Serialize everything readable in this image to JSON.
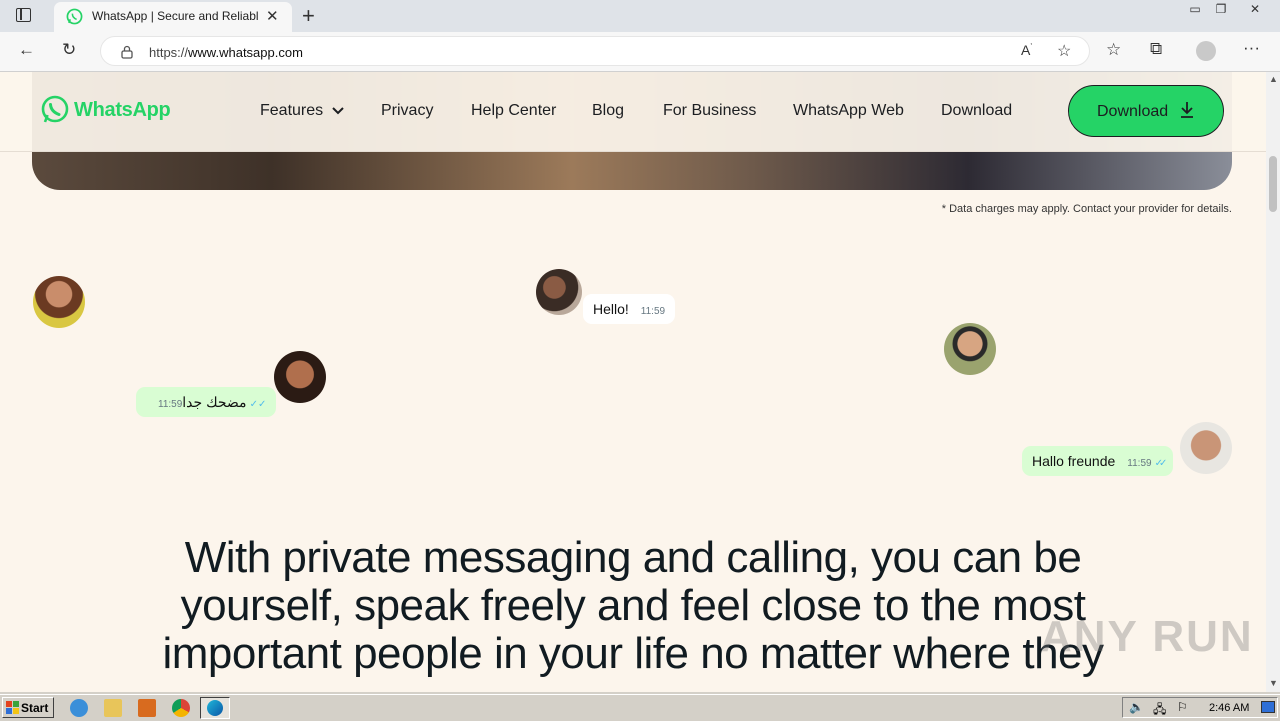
{
  "browser": {
    "tab_title": "WhatsApp | Secure and Reliable",
    "url_scheme": "https://",
    "url_host": "www.whatsapp.com",
    "new_tab_label": "+"
  },
  "site": {
    "logo_text": "WhatsApp",
    "nav": {
      "features": "Features",
      "privacy": "Privacy",
      "help_center": "Help Center",
      "blog": "Blog",
      "for_business": "For Business",
      "whatsapp_web": "WhatsApp Web",
      "download": "Download"
    },
    "download_button": "Download",
    "disclaimer": "* Data charges may apply. Contact your provider for details.",
    "brand_color": "#25d366"
  },
  "chats": [
    {
      "text": "Hello!",
      "time": "11:59"
    },
    {
      "text": "مضحك جدا",
      "time": "11:59"
    },
    {
      "text": "Hallo freunde",
      "time": "11:59"
    }
  ],
  "headline": "With private messaging and calling, you can be yourself, speak freely and feel close to the most important people in your life no matter where they are.",
  "watermark": "ANY RUN",
  "taskbar": {
    "start_label": "Start",
    "clock": "2:46 AM"
  }
}
